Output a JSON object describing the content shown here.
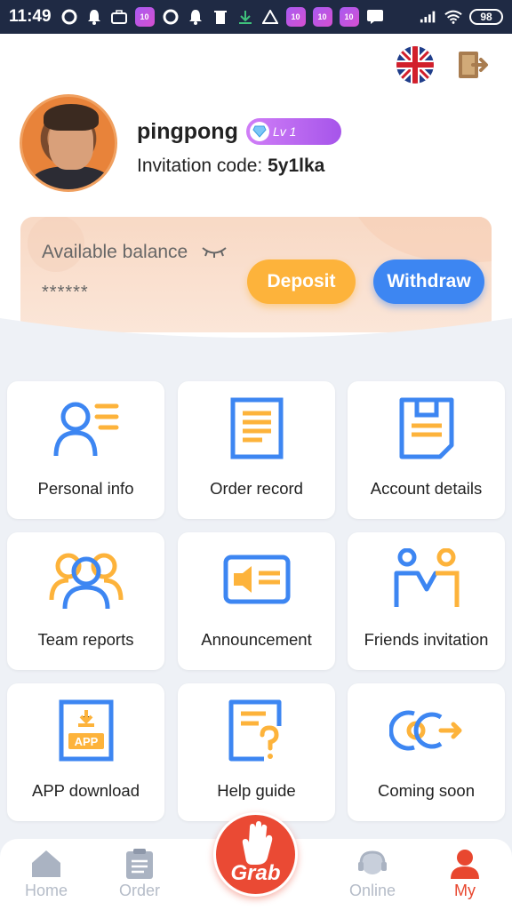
{
  "status_bar": {
    "time": "11:49",
    "battery": "98",
    "app_badge": "10"
  },
  "profile": {
    "username": "pingpong",
    "level": "Lv 1",
    "invitation_label": "Invitation code:",
    "invitation_code": "5y1lka"
  },
  "balance": {
    "label": "Available balance",
    "value": "******",
    "deposit_label": "Deposit",
    "withdraw_label": "Withdraw"
  },
  "menu": [
    {
      "label": "Personal info",
      "icon": "user-list-icon"
    },
    {
      "label": "Order record",
      "icon": "document-icon"
    },
    {
      "label": "Account details",
      "icon": "clipboard-icon"
    },
    {
      "label": "Team reports",
      "icon": "team-icon"
    },
    {
      "label": "Announcement",
      "icon": "megaphone-icon"
    },
    {
      "label": "Friends invitation",
      "icon": "friends-icon"
    },
    {
      "label": "APP download",
      "icon": "app-download-icon"
    },
    {
      "label": "Help guide",
      "icon": "help-icon"
    },
    {
      "label": "Coming soon",
      "icon": "coming-soon-icon"
    }
  ],
  "nav": {
    "home": "Home",
    "order": "Order",
    "grab": "Grab",
    "online": "Online",
    "my": "My"
  },
  "colors": {
    "accent_blue": "#3d86f2",
    "accent_orange": "#fdb33b",
    "grab_red": "#ea4a34",
    "status_bar": "#1f2a44"
  }
}
